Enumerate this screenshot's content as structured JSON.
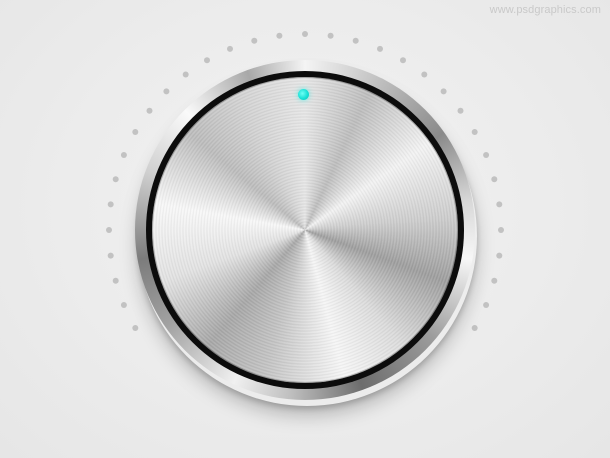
{
  "watermark": {
    "text": "www.psdgraphics.com"
  },
  "knob": {
    "value_fraction": 0.5,
    "tick_count": 33,
    "colors": {
      "background": "#ebebeb",
      "tick_dot": "#c2c2c2",
      "indicator": "#18e0d6",
      "rim": "#0c0c0c"
    },
    "icons": {
      "indicator": "indicator-dot-icon",
      "tick": "tick-dot-icon"
    }
  }
}
